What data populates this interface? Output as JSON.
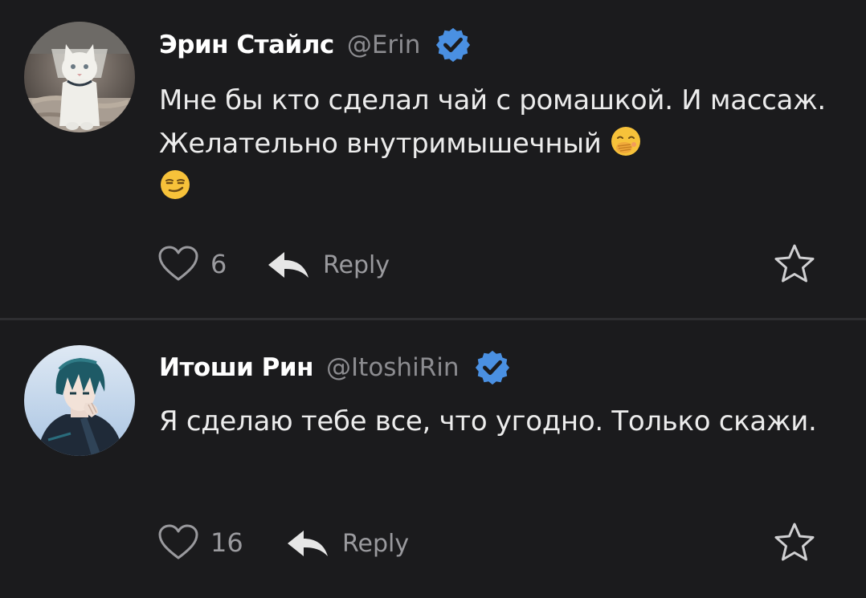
{
  "comments": [
    {
      "author_name": "Эрин Стайлс",
      "handle": "@Erin",
      "verified": true,
      "text": "Мне бы кто сделал чай с ромашкой. И массаж. Желательно внутримышечный",
      "emojis": [
        "hand-over-mouth-emoji",
        "smirking-face-emoji"
      ],
      "like_count": "6",
      "reply_label": "Reply",
      "avatar": "white-cat-avatar"
    },
    {
      "author_name": "Итоши Рин",
      "handle": "@ItoshiRin",
      "verified": true,
      "text": "Я сделаю тебе все, что угодно. Только скажи.",
      "emojis": [],
      "like_count": "16",
      "reply_label": "Reply",
      "avatar": "anime-character-avatar"
    }
  ],
  "colors": {
    "background": "#1b1b1d",
    "divider": "#2e2e31",
    "verified_badge": "#4a90e2",
    "muted_text": "#9a9a9e"
  }
}
